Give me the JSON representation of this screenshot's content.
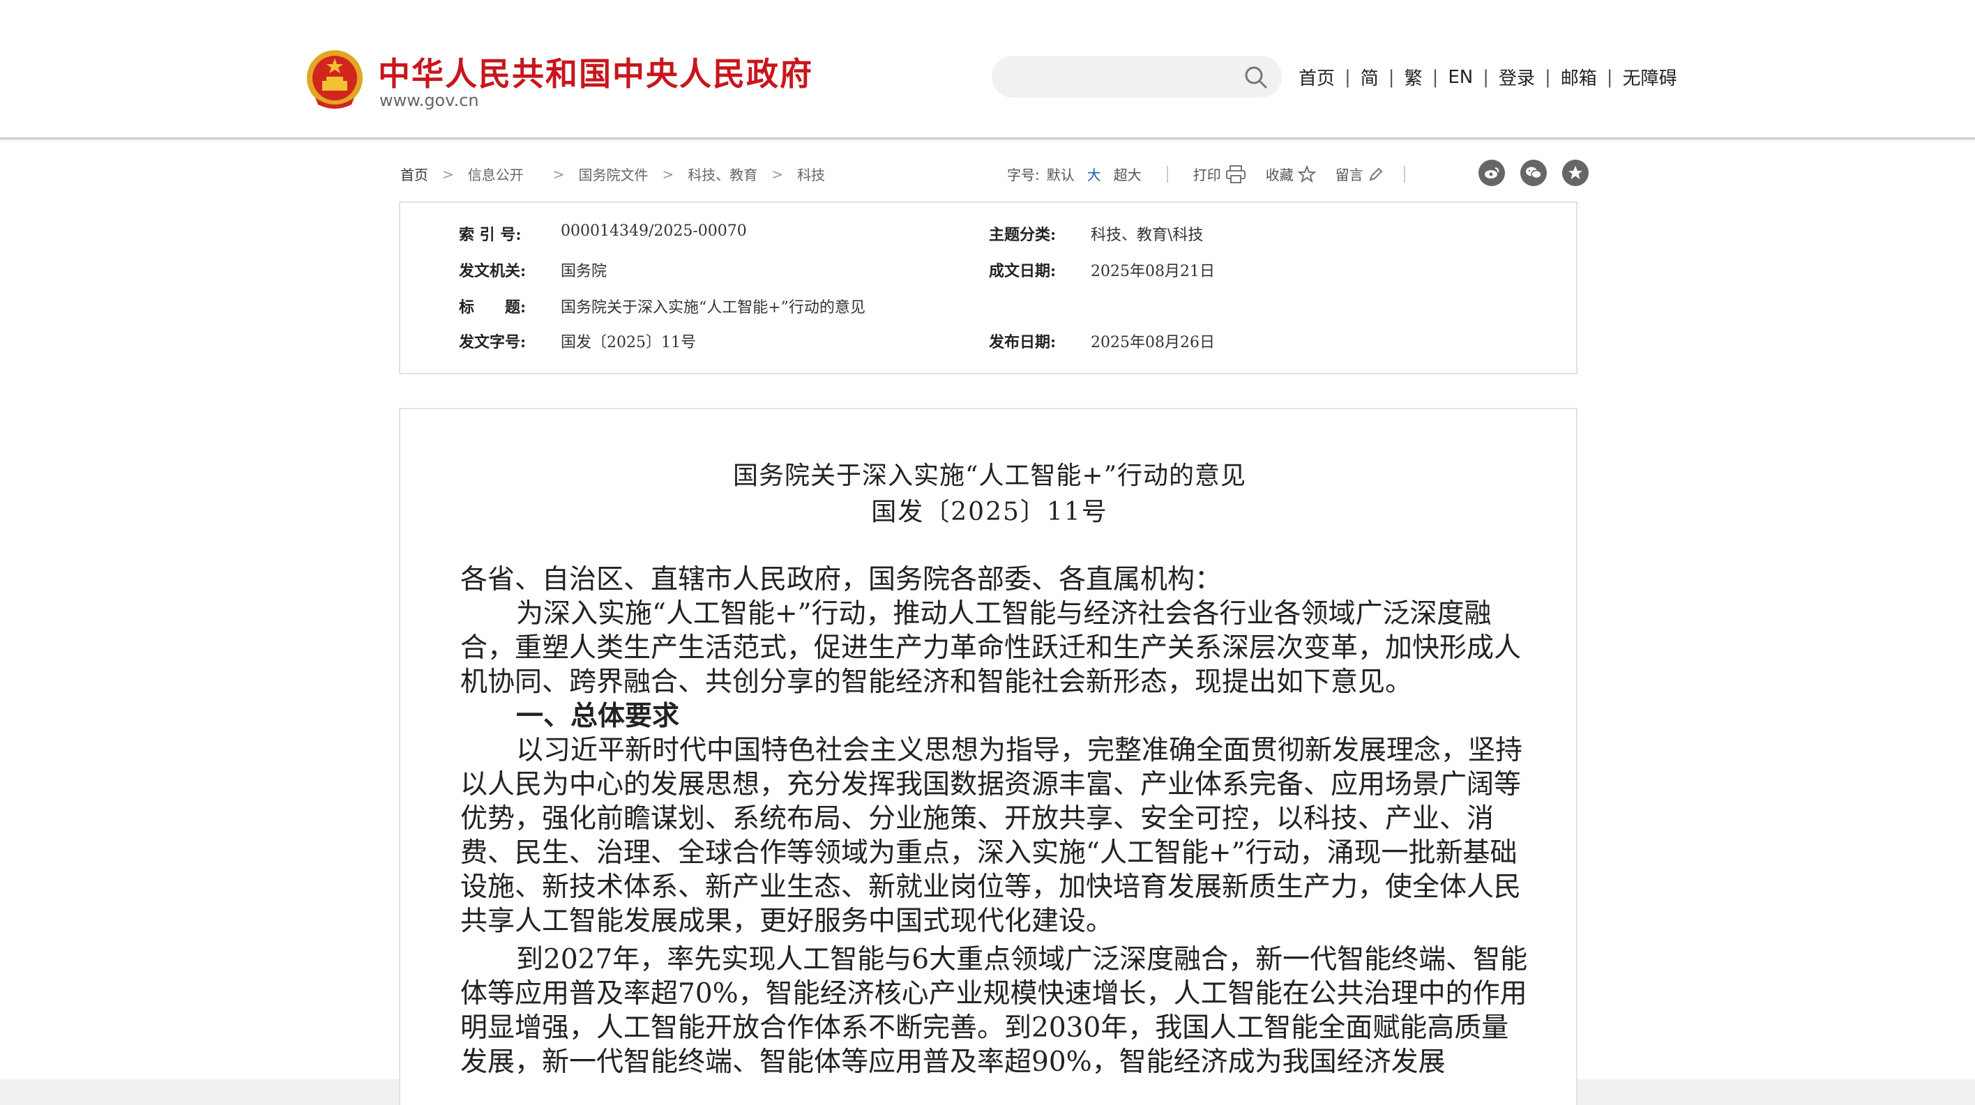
{
  "header": {
    "site_name": "中华人民共和国中央人民政府",
    "site_domain": "www.gov.cn",
    "search_placeholder": "",
    "nav": [
      "首页",
      "简",
      "繁",
      "EN",
      "登录",
      "邮箱",
      "无障碍"
    ]
  },
  "colors": {
    "brand_red": "#c8161d",
    "link_blue": "#1f5bb5",
    "border": "#e2e2e2"
  },
  "breadcrumb": [
    "首页",
    "信息公开",
    "国务院文件",
    "科技、教育",
    "科技"
  ],
  "toolbar": {
    "font_label": "字号:",
    "font_options": [
      "默认",
      "大",
      "超大"
    ],
    "print_label": "打印",
    "favorite_label": "收藏",
    "comment_label": "留言",
    "share_icons": [
      "weibo-icon",
      "wechat-icon",
      "qzone-icon"
    ]
  },
  "meta": {
    "index_label": "索 引 号:",
    "index_value": "000014349/2025-00070",
    "topic_label": "主题分类:",
    "topic_value": "科技、教育\\科技",
    "issuer_label": "发文机关:",
    "issuer_value": "国务院",
    "written_label": "成文日期:",
    "written_value": "2025年08月21日",
    "title_label": "标　　题:",
    "title_value": "国务院关于深入实施“人工智能+”行动的意见",
    "docno_label": "发文字号:",
    "docno_value": "国发〔2025〕11号",
    "published_label": "发布日期:",
    "published_value": "2025年08月26日"
  },
  "article": {
    "title": "国务院关于深入实施“人工智能+”行动的意见",
    "doc_number": "国发〔2025〕11号",
    "salutation": "各省、自治区、直辖市人民政府，国务院各部委、各直属机构：",
    "intro": "为深入实施“人工智能+”行动，推动人工智能与经济社会各行业各领域广泛深度融合，重塑人类生产生活范式，促进生产力革命性跃迁和生产关系深层次变革，加快形成人机协同、跨界融合、共创分享的智能经济和智能社会新形态，现提出如下意见。",
    "section1": "一、总体要求",
    "para1": "以习近平新时代中国特色社会主义思想为指导，完整准确全面贯彻新发展理念，坚持以人民为中心的发展思想，充分发挥我国数据资源丰富、产业体系完备、应用场景广阔等优势，强化前瞻谋划、系统布局、分业施策、开放共享、安全可控，以科技、产业、消费、民生、治理、全球合作等领域为重点，深入实施“人工智能+”行动，涌现一批新基础设施、新技术体系、新产业生态、新就业岗位等，加快培育发展新质生产力，使全体人民共享人工智能发展成果，更好服务中国式现代化建设。",
    "para2": "到2027年，率先实现人工智能与6大重点领域广泛深度融合，新一代智能终端、智能体等应用普及率超70%，智能经济核心产业规模快速增长，人工智能在公共治理中的作用明显增强，人工智能开放合作体系不断完善。到2030年，我国人工智能全面赋能高质量发展，新一代智能终端、智能体等应用普及率超90%，智能经济成为我国经济发展"
  }
}
